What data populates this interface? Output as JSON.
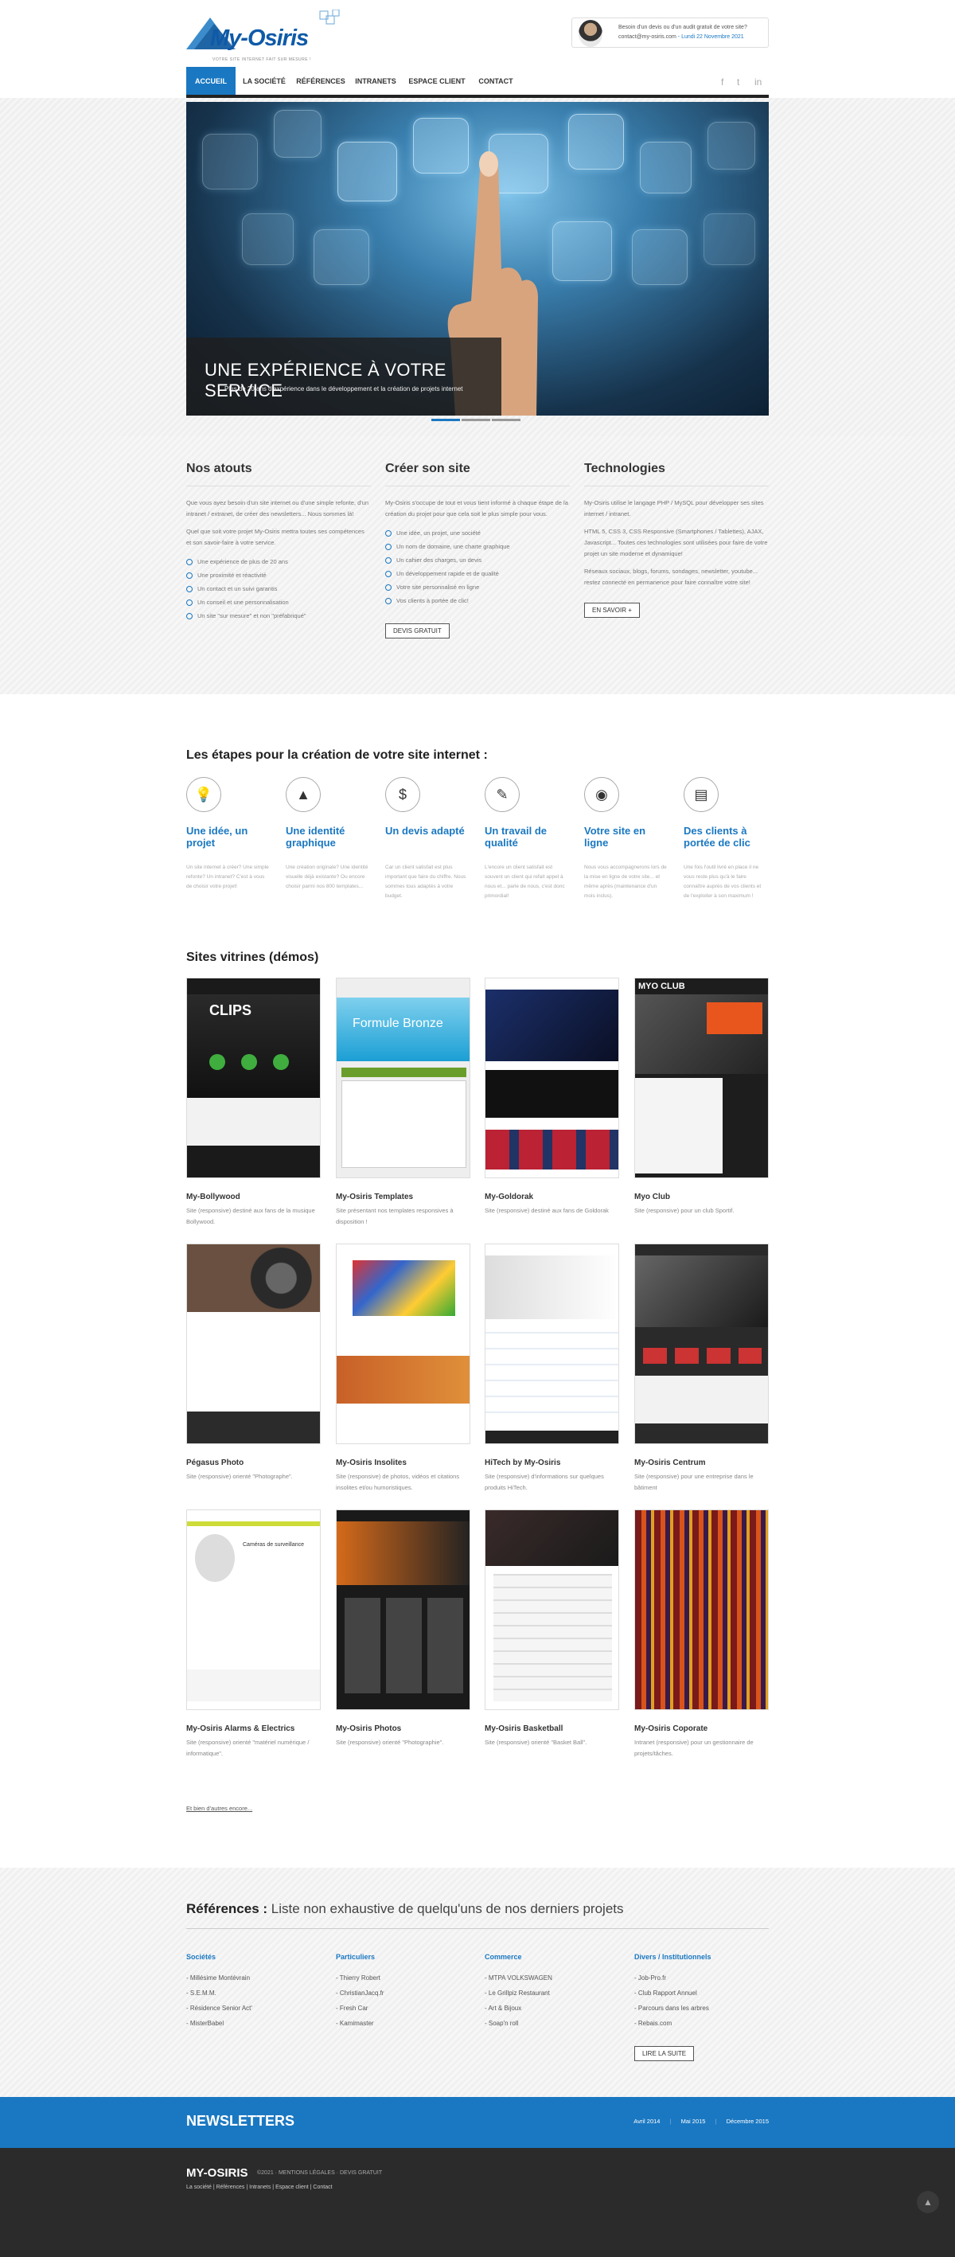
{
  "header": {
    "logo_text": "My-Osiris",
    "tagline": "VOTRE SITE INTERNET FAIT SUR MESURE !",
    "contact_line1": "Besoin d'un devis ou d'un audit gratuit de votre site?",
    "contact_email": "contact@my-osiris.com",
    "contact_date": " - Lundi 22 Novembre 2021",
    "nav": [
      "ACCUEIL",
      "LA SOCIÉTÉ",
      "RÉFÉRENCES",
      "INTRANETS",
      "ESPACE CLIENT",
      "CONTACT"
    ],
    "social": [
      "f",
      "t",
      "in"
    ]
  },
  "hero": {
    "title": "UNE EXPÉRIENCE À VOTRE SERVICE",
    "subtitle": "Plus de 20 ans d'expérience dans le développement et la création de projets internet"
  },
  "features": {
    "atouts": {
      "title": "Nos atouts",
      "p1": "Que vous ayez besoin d'un site internet ou d'une simple refonte, d'un intranet / extranet, de créer des newsletters... Nous sommes là!",
      "p2": "Quel que soit votre projet My-Osiris mettra toutes ses compétences et son savoir-faire à votre service.",
      "items": [
        "Une expérience de plus de 20 ans",
        "Une proximité et réactivité",
        "Un contact et un suivi garantis",
        "Un conseil et une personnalisation",
        "Un site \"sur mesure\" et non \"préfabriqué\""
      ]
    },
    "creer": {
      "title": "Créer son site",
      "p1": "My-Osiris s'occupe de tout et vous tient informé à chaque étape de la création du projet pour que cela soit le plus simple pour vous.",
      "items": [
        "Une idée, un projet, une société",
        "Un nom de domaine, une charte graphique",
        "Un cahier des charges, un devis",
        "Un développement rapide et de qualité",
        "Votre site personnalisé en ligne",
        "Vos clients à portée de clic!"
      ],
      "button": "DEVIS GRATUIT"
    },
    "tech": {
      "title": "Technologies",
      "p1": "My-Osiris utilise le langage PHP / MySQL pour développer ses sites internet / intranet.",
      "p2": "HTML 5, CSS 3, CSS Responsive (Smartphones / Tablettes), AJAX, Javascript... Toutes ces technologies sont utilisées pour faire de votre projet un site moderne et dynamique!",
      "p3": "Réseaux sociaux, blogs, forums, sondages, newsletter, youtube... restez connecté en permanence pour faire connaître votre site!",
      "button": "EN SAVOIR +"
    }
  },
  "steps": {
    "title": "Les étapes pour la création de votre site internet :",
    "items": [
      {
        "title": "Une idée, un projet",
        "text": "Un site internet à créer? Une simple refonte? Un intranet? C'est à vous de choisir votre projet!",
        "icon": "lightbulb-icon",
        "glyph": "💡"
      },
      {
        "title": "Une identité graphique",
        "text": "Une création originale? Une identité visuelle déjà existante? Ou encore choisir parmi nos 800 templates...",
        "icon": "chart-icon",
        "glyph": "▲"
      },
      {
        "title": "Un devis adapté",
        "text": "Car un client satisfait est plus important que faire du chiffre. Nous sommes tous adaptés à votre budget.",
        "icon": "money-bag-icon",
        "glyph": "$"
      },
      {
        "title": "Un travail de qualité",
        "text": "L'encore un client satisfait est souvent un client qui refait appel à nous et... parle de nous, c'est donc primordial!",
        "icon": "pencil-icon",
        "glyph": "✎"
      },
      {
        "title": "Votre site en ligne",
        "text": "Nous vous accompagnerons lors de la mise en ligne de votre site... et même après (maintenance d'un mois inclus).",
        "icon": "browser-icon",
        "glyph": "◉"
      },
      {
        "title": "Des clients à portée de clic",
        "text": "Une fois l'outil livré en place il ne vous reste plus qu'à le faire connaître auprès de vos clients et de l'exploiter à son maximum !",
        "icon": "shopping-icon",
        "glyph": "▤"
      }
    ]
  },
  "demos": {
    "title": "Sites vitrines (démos)",
    "items": [
      {
        "name": "My-Bollywood",
        "desc": "Site (responsive) destiné aux fans de la musique Bollywood."
      },
      {
        "name": "My-Osiris Templates",
        "desc": "Site présentant nos templates responsives à disposition !"
      },
      {
        "name": "My-Goldorak",
        "desc": "Site (responsive) destiné aux fans de Goldorak"
      },
      {
        "name": "Myo Club",
        "desc": "Site (responsive) pour un club Sportif."
      },
      {
        "name": "Pégasus Photo",
        "desc": "Site (responsive) orienté \"Photographe\"."
      },
      {
        "name": "My-Osiris Insolites",
        "desc": "Site (responsive) de photos, vidéos et citations insolites et/ou humoristiques."
      },
      {
        "name": "HiTech by My-Osiris",
        "desc": "Site (responsive) d'informations sur quelques produits HiTech."
      },
      {
        "name": "My-Osiris Centrum",
        "desc": "Site (responsive) pour une entreprise dans le bâtiment"
      },
      {
        "name": "My-Osiris Alarms & Electrics",
        "desc": "Site (responsive) orienté \"matériel numérique / informatique\"."
      },
      {
        "name": "My-Osiris Photos",
        "desc": "Site (responsive) orienté \"Photographie\"."
      },
      {
        "name": "My-Osiris Basketball",
        "desc": "Site (responsive) orienté \"Basket Ball\"."
      },
      {
        "name": "My-Osiris Coporate",
        "desc": "Intranet (responsive) pour un gestionnaire de projets/tâches."
      }
    ],
    "thumb_labels": [
      "CLIPS",
      "Formule Bronze",
      "",
      "MYO CLUB",
      "",
      "",
      "",
      "",
      "Caméras de surveillance",
      "",
      "",
      ""
    ],
    "more": "Et bien d'autres encore..."
  },
  "references": {
    "title_bold": "Références :",
    "title_rest": " Liste non exhaustive de quelqu'uns de nos derniers projets",
    "cols": [
      {
        "title": "Sociétés",
        "items": [
          "- Millésime Montévrain",
          "- S.E.M.M.",
          "- Résidence Senior Act'",
          "- MisterBabel"
        ]
      },
      {
        "title": "Particuliers",
        "items": [
          "- Thierry Robert",
          "- ChristianJacq.fr",
          "- Fresh Car",
          "- Kamimaster"
        ]
      },
      {
        "title": "Commerce",
        "items": [
          "- MTPA VOLKSWAGEN",
          "- Le Grillpiz Restaurant",
          "- Art & Bijoux",
          "- Soap'n roll"
        ]
      },
      {
        "title": "Divers / Institutionnels",
        "items": [
          "- Job-Pro.fr",
          "- Club Rapport Annuel",
          "- Parcours dans les arbres",
          "- Rebais.com"
        ]
      }
    ],
    "button": "LIRE LA SUITE"
  },
  "newsletter": {
    "title": "NEWSLETTERS",
    "links": [
      "Avril 2014",
      "Mai 2015",
      "Décembre 2015"
    ]
  },
  "footer": {
    "brand": "MY-OSIRIS",
    "copy": "©2021 · MENTIONS LÉGALES · DEVIS GRATUIT",
    "nav": "La société | Références | Intranets | Espace client | Contact",
    "top_icon": "arrow-up-icon"
  },
  "colors": {
    "accent": "#1a78c2",
    "dark": "#2b2b2b"
  }
}
